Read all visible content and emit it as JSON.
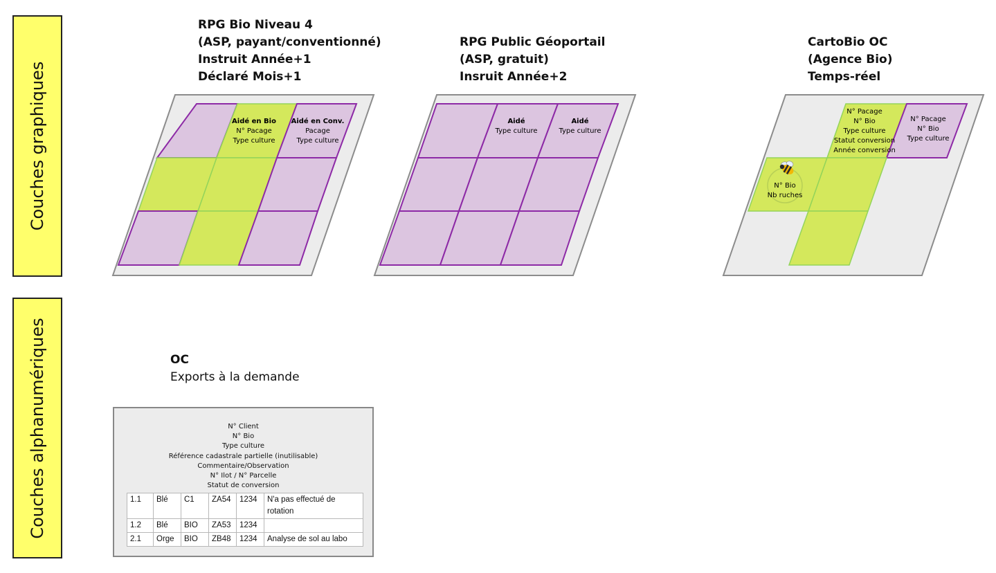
{
  "side_labels": {
    "graph": "Couches graphiques",
    "alpha": "Couches alphanumériques"
  },
  "sources": [
    {
      "lines": [
        "RPG Bio Niveau 4",
        "(ASP, payant/conventionné)",
        "Instruit Année+1",
        "Déclaré Mois+1"
      ],
      "parcels": [
        {
          "title": "Aidé en Bio",
          "lines": [
            "N° Pacage",
            "Type culture"
          ]
        },
        {
          "title": "Aidé en Conv.",
          "lines": [
            "Pacage",
            "Type culture"
          ]
        }
      ]
    },
    {
      "lines": [
        "RPG Public Géoportail",
        "(ASP, gratuit)",
        "Insruit Année+2"
      ],
      "parcels": [
        {
          "title": "Aidé",
          "lines": [
            "Type culture"
          ]
        },
        {
          "title": "Aidé",
          "lines": [
            "Type culture"
          ]
        }
      ]
    },
    {
      "lines": [
        "CartoBio OC",
        "(Agence Bio)",
        "Temps-réel"
      ],
      "parcels": [
        {
          "title": "",
          "lines": [
            "N° Pacage",
            "N° Bio",
            "Type culture",
            "Statut conversion",
            "Année conversion"
          ]
        },
        {
          "title": "",
          "lines": [
            "N° Pacage",
            "N° Bio",
            "Type culture"
          ]
        },
        {
          "title": "",
          "lines": [
            "N° Bio",
            "Nb ruches"
          ]
        }
      ]
    }
  ],
  "oc": {
    "title": "OC",
    "subtitle": "Exports à la demande",
    "fields": [
      "N° Client",
      "N° Bio",
      "Type culture",
      "Référence cadastrale partielle (inutilisable)",
      "Commentaire/Observation",
      "N° Ilot / N° Parcelle",
      "Statut de conversion"
    ],
    "rows": [
      [
        "1.1",
        "Blé",
        "C1",
        "ZA54",
        "1234",
        "N'a pas effectué de rotation"
      ],
      [
        "1.2",
        "Blé",
        "BIO",
        "ZA53",
        "1234",
        ""
      ],
      [
        "2.1",
        "Orge",
        "BIO",
        "ZB48",
        "1234",
        "Analyse de sol au labo"
      ]
    ]
  },
  "colors": {
    "label_bg": "#ffff6b",
    "bio_fill": "#d4e85c",
    "conv_fill": "#dcc5e0",
    "purple_stroke": "#8d2aa6",
    "green_stroke": "#93d45a",
    "panel_bg": "#ececec"
  },
  "icons": {
    "bee": "bee-icon"
  }
}
